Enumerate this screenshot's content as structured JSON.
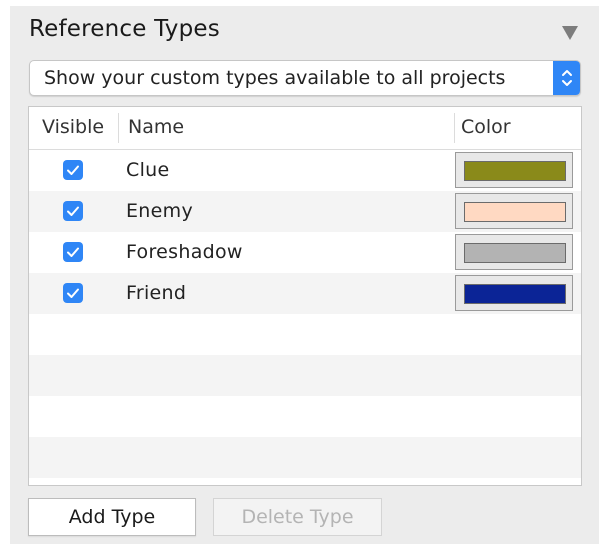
{
  "panel": {
    "title": "Reference Types"
  },
  "scope_popup": {
    "selected": "Show your custom types available to all projects"
  },
  "table": {
    "columns": {
      "visible": "Visible",
      "name": "Name",
      "color": "Color"
    },
    "rows": [
      {
        "visible": true,
        "name": "Clue",
        "color": "#8a8a1a"
      },
      {
        "visible": true,
        "name": "Enemy",
        "color": "#ffd9c2"
      },
      {
        "visible": true,
        "name": "Foreshadow",
        "color": "#b3b3b3"
      },
      {
        "visible": true,
        "name": "Friend",
        "color": "#0b2496"
      }
    ]
  },
  "buttons": {
    "add": "Add Type",
    "delete": "Delete Type"
  },
  "theme": {
    "accent": "#2f86f6"
  }
}
